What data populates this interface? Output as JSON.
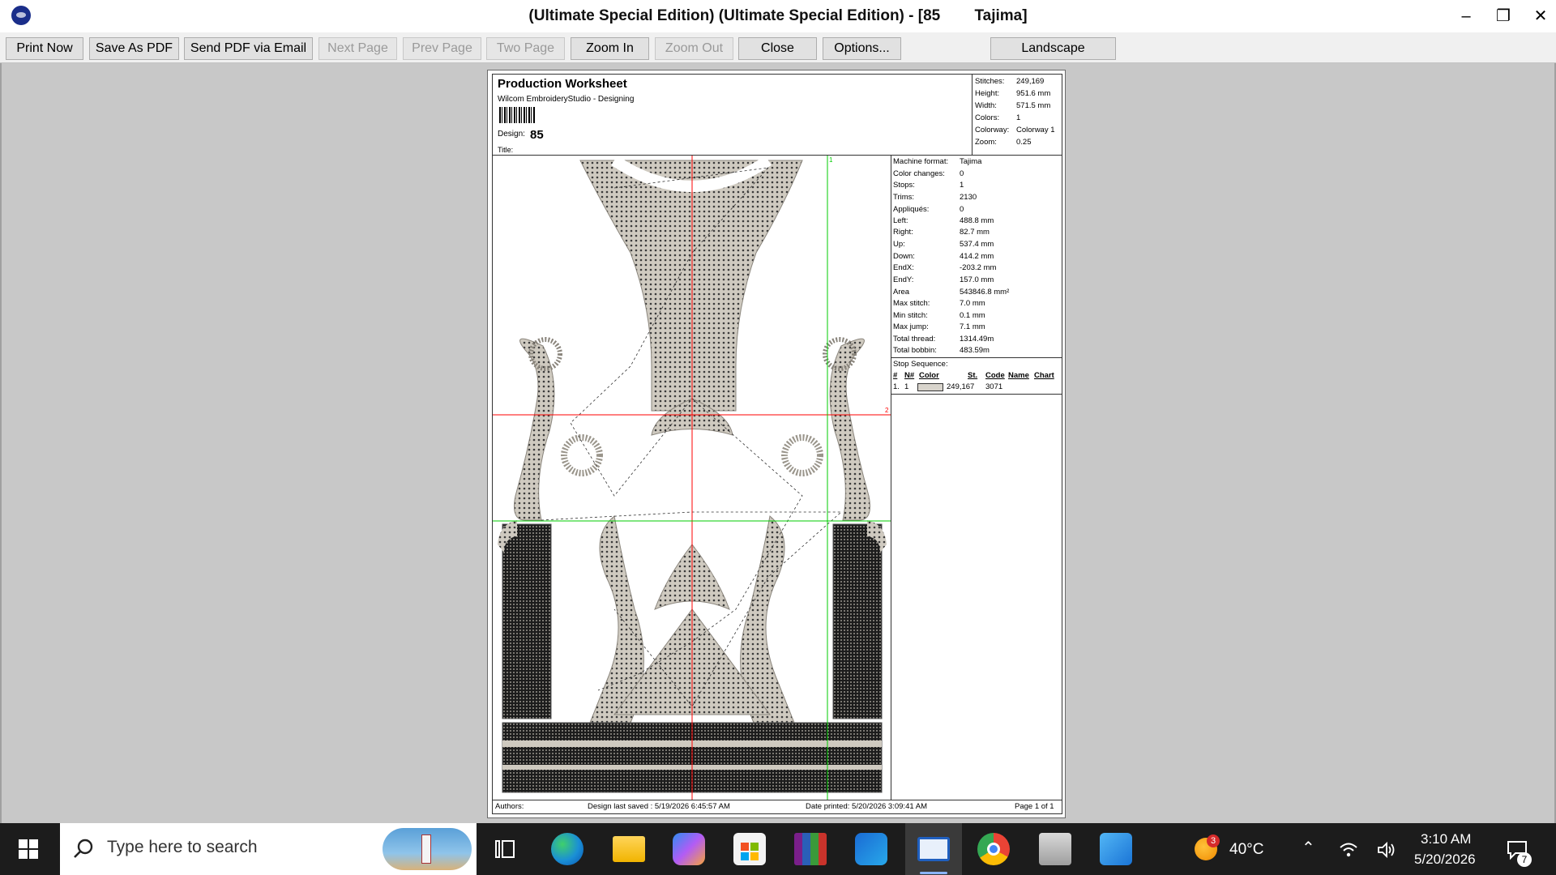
{
  "window": {
    "title": "(Ultimate Special Edition) (Ultimate Special Edition) - [85        Tajima]",
    "controls": [
      "minimize",
      "restore",
      "close"
    ]
  },
  "toolbar": {
    "print_now": "Print Now",
    "save_as_pdf": "Save As PDF",
    "send_pdf_email": "Send PDF via Email",
    "next_page": "Next Page",
    "prev_page": "Prev Page",
    "two_page": "Two Page",
    "zoom_in": "Zoom In",
    "zoom_out": "Zoom Out",
    "close": "Close",
    "options": "Options...",
    "landscape": "Landscape"
  },
  "worksheet": {
    "title": "Production Worksheet",
    "subtitle": "Wilcom EmbroideryStudio - Designing",
    "design_label": "Design:",
    "design_value": "85",
    "title_label": "Title:",
    "summary": [
      {
        "label": "Stitches:",
        "value": "249,169"
      },
      {
        "label": "Height:",
        "value": "951.6 mm"
      },
      {
        "label": "Width:",
        "value": "571.5 mm"
      },
      {
        "label": "Colors:",
        "value": "1"
      },
      {
        "label": "Colorway:",
        "value": "Colorway 1"
      },
      {
        "label": "Zoom:",
        "value": "0.25"
      }
    ],
    "details": [
      {
        "label": "Machine format:",
        "value": "Tajima"
      },
      {
        "label": "Color changes:",
        "value": "0"
      },
      {
        "label": "Stops:",
        "value": "1"
      },
      {
        "label": "Trims:",
        "value": "2130"
      },
      {
        "label": "Appliqués:",
        "value": "0"
      },
      {
        "label": "Left:",
        "value": "488.8 mm"
      },
      {
        "label": "Right:",
        "value": "82.7 mm"
      },
      {
        "label": "Up:",
        "value": "537.4 mm"
      },
      {
        "label": "Down:",
        "value": "414.2 mm"
      },
      {
        "label": "EndX:",
        "value": "-203.2 mm"
      },
      {
        "label": "EndY:",
        "value": "157.0 mm"
      },
      {
        "label": "Area",
        "value": "543846.8 mm²"
      },
      {
        "label": "Max stitch:",
        "value": "7.0 mm"
      },
      {
        "label": "Min stitch:",
        "value": "0.1 mm"
      },
      {
        "label": "Max jump:",
        "value": "7.1 mm"
      },
      {
        "label": "Total thread:",
        "value": "1314.49m"
      },
      {
        "label": "Total bobbin:",
        "value": "483.59m"
      }
    ],
    "stop_sequence": {
      "label": "Stop Sequence:",
      "headers": [
        "#",
        "N#",
        "Color",
        "St.",
        "Code",
        "Name",
        "Chart"
      ],
      "row": {
        "num": "1.",
        "n": "1",
        "color": "#d8d4cc",
        "stitches": "249,167",
        "code": "3071"
      }
    },
    "footer": {
      "authors": "Authors:",
      "last_saved": "Design last saved : 5/19/2026 6:45:57 AM",
      "date_printed": "Date printed: 5/20/2026 3:09:41 AM",
      "page": "Page 1 of 1"
    },
    "axis_marks": {
      "red_end": "2",
      "green_top": "1"
    }
  },
  "taskbar": {
    "search_placeholder": "Type here to search",
    "weather_temp": "40°C",
    "weather_badge": "3",
    "time": "3:10 AM",
    "date": "5/20/2026",
    "notification_count": "7",
    "apps": [
      "task-view",
      "edge",
      "file-explorer",
      "copilot",
      "microsoft-store",
      "winrar",
      "outlook",
      "embroidery-studio",
      "chrome",
      "photo-viewer",
      "paint"
    ]
  }
}
